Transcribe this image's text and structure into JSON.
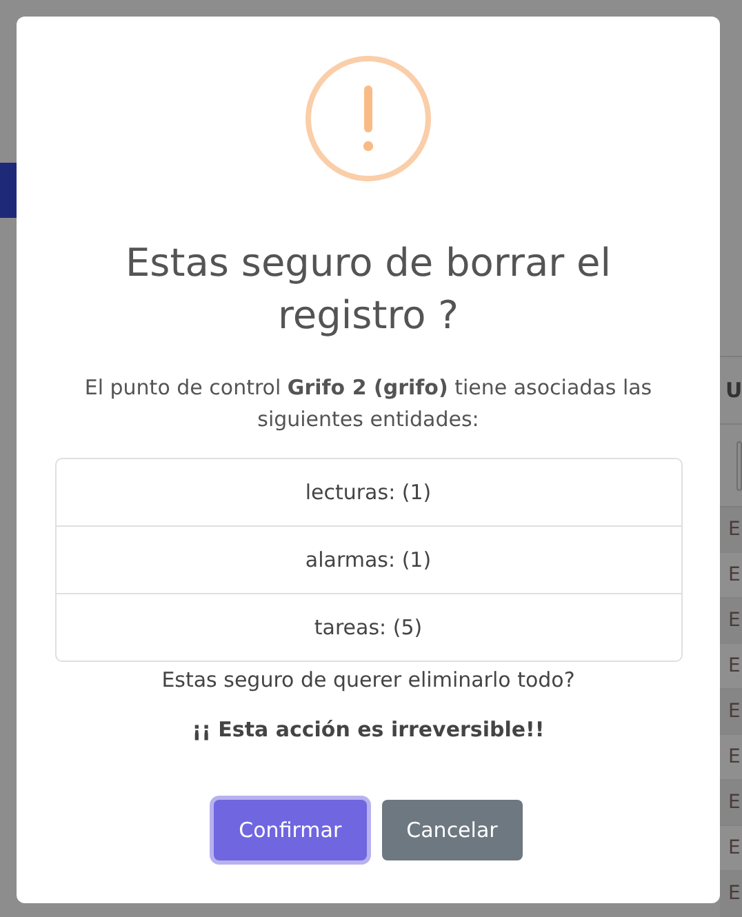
{
  "background": {
    "right_header": "U",
    "right_cells": [
      "E",
      "E",
      "E",
      "E",
      "E",
      "E",
      "E",
      "E",
      "E"
    ]
  },
  "dialog": {
    "title": "Estas seguro de borrar el registro ?",
    "message": "El punto de control **Grifo 2 (grifo)** tiene asociadas las siguientes entidades:",
    "entities": [
      "lecturas: (1)",
      "alarmas: (1)",
      "tareas: (5)"
    ],
    "question": "Estas seguro de querer eliminarlo todo?",
    "warning": "¡¡ Esta acción es irreversible!!",
    "buttons": [
      {
        "label": "Confirmar",
        "kind": "confirm",
        "focused": true
      },
      {
        "label": "Cancelar",
        "kind": "cancel",
        "focused": false
      }
    ]
  }
}
